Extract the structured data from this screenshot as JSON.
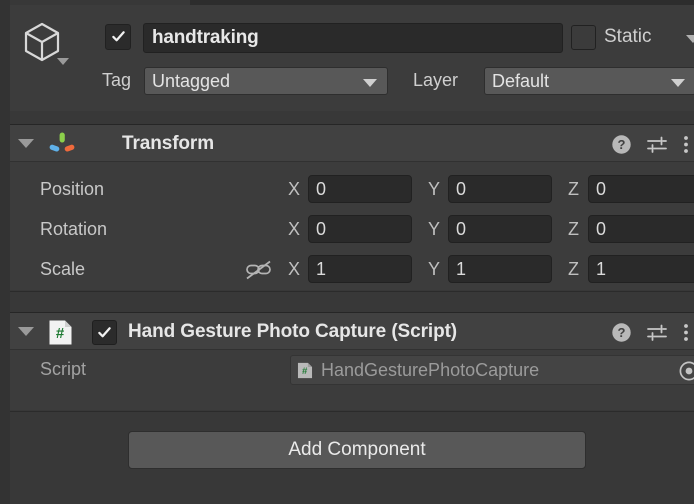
{
  "window": {
    "panel": "Inspector"
  },
  "gameobject": {
    "icon": "cube-gameobject-icon",
    "enabled_checkbox": "checked",
    "name": "handtraking",
    "static": {
      "label": "Static",
      "checked": false
    },
    "tag": {
      "label": "Tag",
      "value": "Untagged"
    },
    "layer": {
      "label": "Layer",
      "value": "Default"
    }
  },
  "components": [
    {
      "id": "transform",
      "title": "Transform",
      "icon": "transform-axis-gizmo-icon",
      "expanded": true,
      "has_enable_checkbox": false,
      "header_icons": [
        "help-icon",
        "preset-icon",
        "more-menu-icon"
      ],
      "rows": [
        {
          "label": "Position",
          "x": "0",
          "y": "0",
          "z": "0",
          "axis_labels": [
            "X",
            "Y",
            "Z"
          ]
        },
        {
          "label": "Rotation",
          "x": "0",
          "y": "0",
          "z": "0",
          "axis_labels": [
            "X",
            "Y",
            "Z"
          ]
        },
        {
          "label": "Scale",
          "x": "1",
          "y": "1",
          "z": "1",
          "axis_labels": [
            "X",
            "Y",
            "Z"
          ],
          "constrain_icon": "constrain-proportions-off-icon"
        }
      ]
    },
    {
      "id": "hand-gesture-photo-capture",
      "title": "Hand Gesture Photo Capture (Script)",
      "icon": "csharp-script-icon",
      "expanded": true,
      "has_enable_checkbox": true,
      "enabled": true,
      "header_icons": [
        "help-icon",
        "preset-icon",
        "more-menu-icon"
      ],
      "fields": [
        {
          "label": "Script",
          "value": "HandGesturePhotoCapture",
          "field_icon": "csharp-script-icon",
          "picker_icon": "object-picker-icon",
          "readonly": true
        }
      ]
    }
  ],
  "footer": {
    "add_component_label": "Add Component"
  },
  "colors": {
    "background": "#383838",
    "panel": "#3c3c3c",
    "component_header": "#414141",
    "field_dark": "#2a2a2a",
    "dropdown": "#585858",
    "text": "#d2d2d2",
    "text_dim": "#9b9b9b",
    "axis_x": "#f06a3c",
    "axis_y": "#8ccf4b",
    "axis_z": "#5fb0e8",
    "csharp_green": "#1f7a33"
  }
}
